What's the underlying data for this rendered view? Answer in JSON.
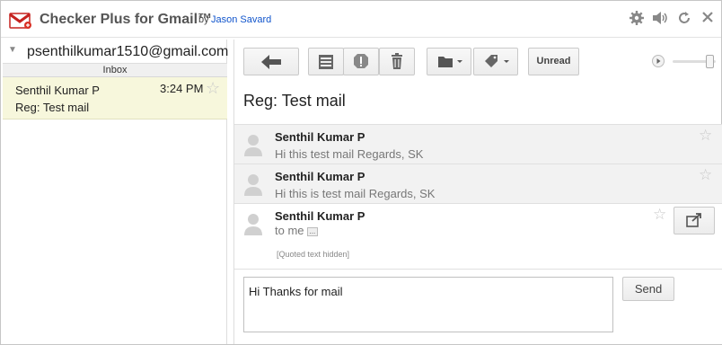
{
  "titlebar": {
    "app_title": "Checker Plus for Gmail™",
    "by": "by",
    "author": "Jason Savard",
    "icons": [
      "gear-icon",
      "speaker-icon",
      "refresh-icon",
      "close-icon"
    ]
  },
  "left": {
    "account_email": "psenthilkumar1510@gmail.com",
    "folder_label": "Inbox",
    "mail_item": {
      "from": "Senthil Kumar P",
      "time": "3:24 PM",
      "subject": "Reg: Test mail"
    }
  },
  "toolbar": {
    "unread_label": "Unread",
    "icons": [
      "back-arrow-icon",
      "archive-icon",
      "spam-icon",
      "delete-icon",
      "folder-icon",
      "label-icon",
      "play-icon"
    ],
    "volume_level": 0.85
  },
  "thread": {
    "subject": "Reg: Test mail",
    "messages": [
      {
        "from": "Senthil Kumar P",
        "snippet": "Hi this test mail Regards, SK"
      },
      {
        "from": "Senthil Kumar P",
        "snippet": "Hi this is test mail Regards, SK"
      },
      {
        "from": "Senthil Kumar P",
        "to_line": "to me",
        "ellipsis": "...",
        "quoted_text": "[Quoted text hidden]"
      }
    ]
  },
  "reply": {
    "value": "Hi Thanks for mail",
    "send_label": "Send"
  },
  "colors": {
    "accent_link": "#1155cc",
    "selected_item_bg": "#f7f7dc",
    "logo_red": "#d93025"
  }
}
